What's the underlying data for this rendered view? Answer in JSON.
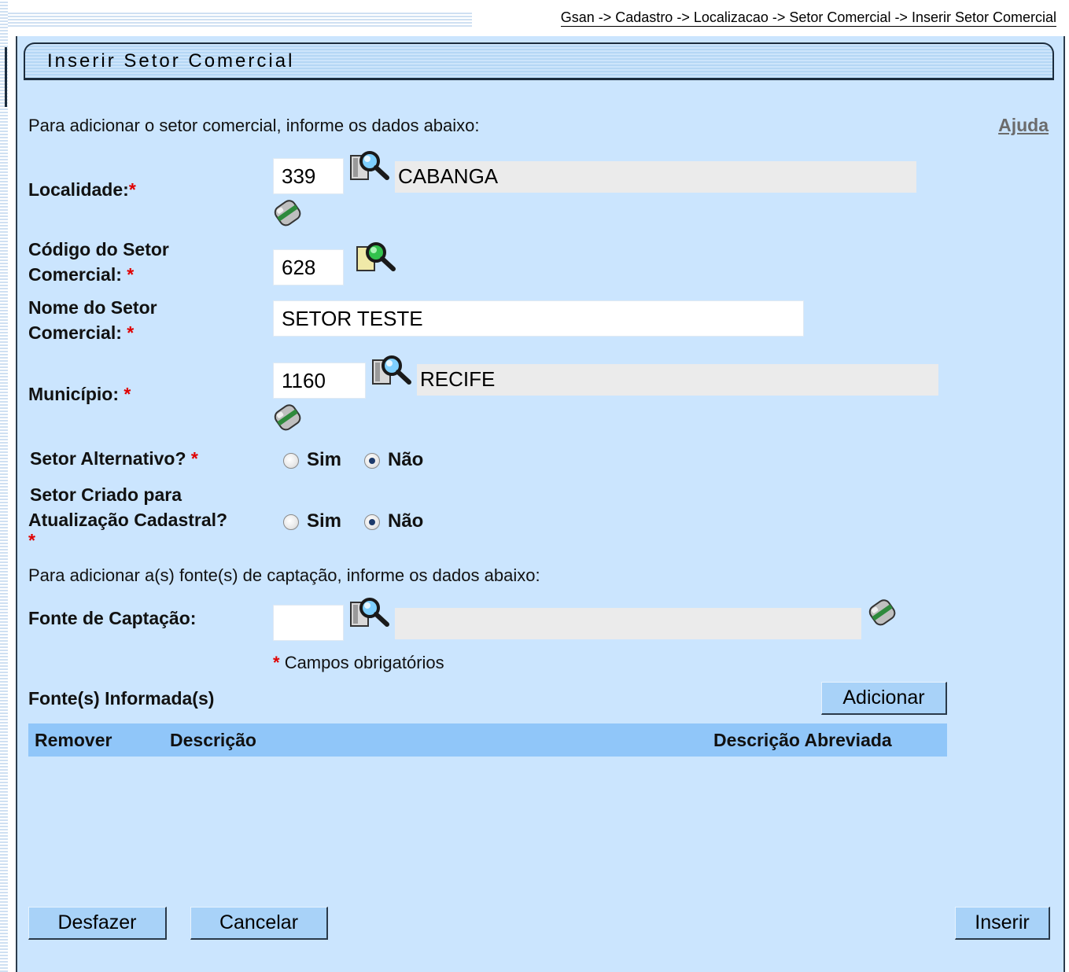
{
  "breadcrumb": "Gsan -> Cadastro -> Localizacao -> Setor Comercial -> Inserir Setor Comercial",
  "panel_title": "Inserir Setor Comercial",
  "intro_text": "Para adicionar o setor comercial, informe os dados abaixo:",
  "help_link": "Ajuda",
  "required_mark": "*",
  "fields": {
    "localidade": {
      "label": "Localidade:",
      "code": "339",
      "description": "CABANGA"
    },
    "codigo_setor": {
      "label_line1": "Código do Setor",
      "label_line2": "Comercial:",
      "value": "628"
    },
    "nome_setor": {
      "label_line1": "Nome do Setor",
      "label_line2": "Comercial:",
      "value": "SETOR TESTE"
    },
    "municipio": {
      "label": "Município:",
      "code": "1160",
      "description": "RECIFE"
    },
    "setor_alternativo": {
      "label": "Setor Alternativo?",
      "options": [
        "Sim",
        "Não"
      ],
      "selected": "Não"
    },
    "setor_criado": {
      "label_line1": "Setor Criado para",
      "label_line2": "Atualização Cadastral?",
      "options": [
        "Sim",
        "Não"
      ],
      "selected": "Não"
    },
    "fonte_captacao": {
      "label": "Fonte de Captação:",
      "code": "",
      "description": ""
    }
  },
  "fonte_intro_text": "Para adicionar a(s) fonte(s) de captação, informe os dados abaixo:",
  "required_note": "Campos obrigatórios",
  "fontes_section_title": "Fonte(s) Informada(s)",
  "table": {
    "columns": [
      "Remover",
      "Descrição",
      "Descrição Abreviada"
    ],
    "rows": []
  },
  "buttons": {
    "adicionar": "Adicionar",
    "desfazer": "Desfazer",
    "cancelar": "Cancelar",
    "inserir": "Inserir"
  },
  "icons": {
    "search": "magnifier-search-icon",
    "clear": "eraser-icon"
  }
}
